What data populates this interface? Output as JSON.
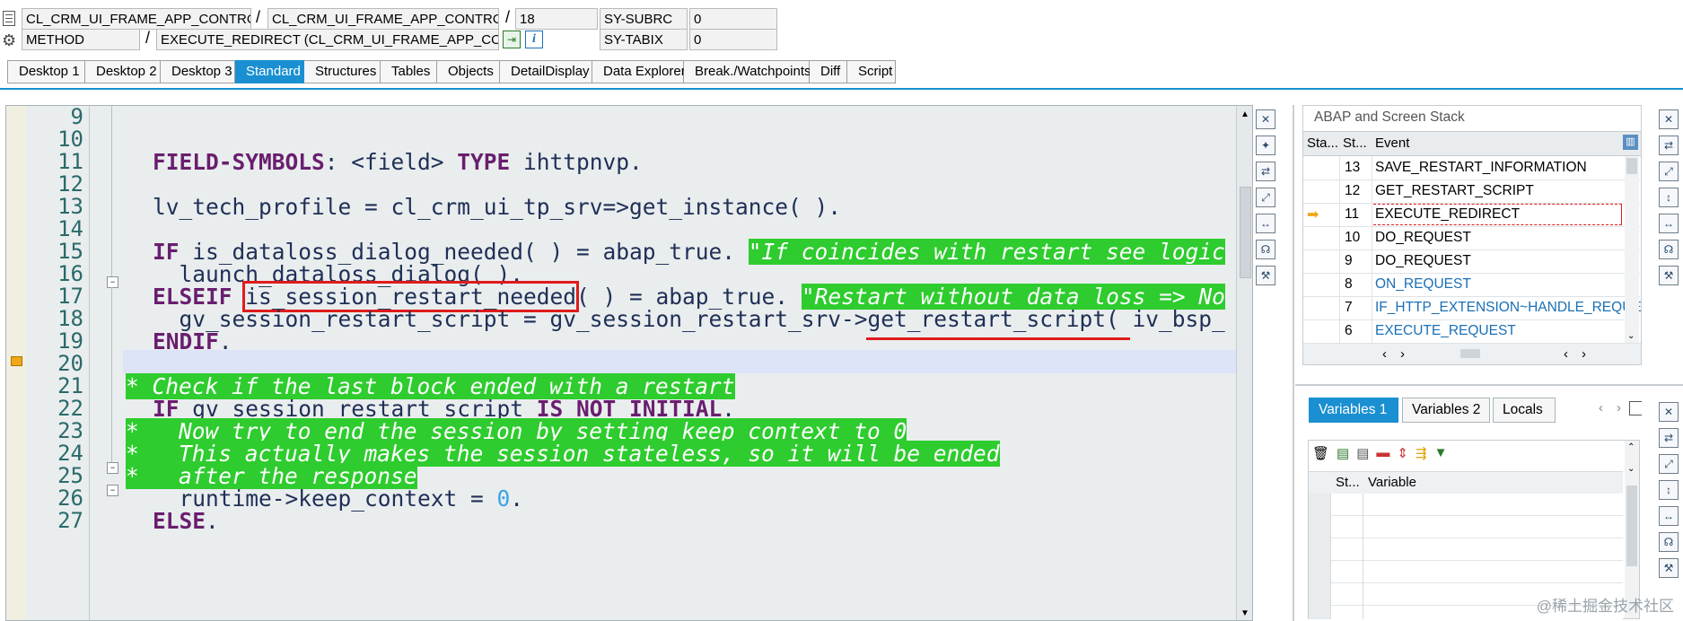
{
  "header": {
    "row1": {
      "class_field": "CL_CRM_UI_FRAME_APP_CONTROLLE...",
      "include_field": "CL_CRM_UI_FRAME_APP_CONTROLLE...",
      "line_field": "18",
      "sysvar_label": "SY-SUBRC",
      "sysvar_value": "0"
    },
    "row2": {
      "type_field": "METHOD",
      "method_field": "EXECUTE_REDIRECT (CL_CRM_UI_FRAME_APP_CONTROLLE...",
      "sysvar_label": "SY-TABIX",
      "sysvar_value": "0"
    },
    "separator": "/"
  },
  "tabs": [
    "Desktop 1",
    "Desktop 2",
    "Desktop 3",
    "Standard",
    "Structures",
    "Tables",
    "Objects",
    "DetailDisplay",
    "Data Explorer",
    "Break./Watchpoints",
    "Diff",
    "Script"
  ],
  "active_tab": "Standard",
  "code": {
    "line_numbers": [
      "9",
      "10",
      "11",
      "12",
      "13",
      "14",
      "15",
      "16",
      "17",
      "18",
      "19",
      "20",
      "21",
      "22",
      "23",
      "24",
      "25",
      "26",
      "27"
    ],
    "l11_kw1": "FIELD-SYMBOLS",
    "l11_rest": ": <field> ",
    "l11_kw2": "TYPE",
    "l11_type": " ihttpnvp.",
    "l13": "lv_tech_profile = cl_crm_ui_tp_srv=>get_instance( ).",
    "l15_kw": "IF",
    "l15_rest": " is_dataloss_dialog_needed( ) = abap_true. ",
    "l15_comment": "\"If coincides with restart see logic",
    "l16": "  launch_dataloss_dialog( ).",
    "l17_kw": "ELSEIF",
    "l17_boxed": "is_session_restart_needed",
    "l17_rest": "( ) = abap_true. ",
    "l17_comment": "\"Restart without data loss => No",
    "l18_a": "  gv_session_restart_script = gv_session_restart_srv->",
    "l18_b": "get_restart_script",
    "l18_c": "( iv_bsp_",
    "l19_kw": "ENDIF",
    "l19_rest": ".",
    "l21_comment": "* Check if the last block ended with a restart",
    "l22_kw1": "IF",
    "l22_rest": " gv_session_restart_script ",
    "l22_kw2": "IS NOT INITIAL",
    "l22_end": ".",
    "l23_comment": "*   Now try to end the session by setting keep_context to 0",
    "l24_comment": "*   This actually makes the session stateless, so it will be ended",
    "l25_comment": "*   after the response",
    "l26_a": "  runtime->keep_context = ",
    "l26_num": "0",
    "l26_b": ".",
    "l27_kw": "ELSE",
    "l27_rest": "."
  },
  "stack": {
    "title": "ABAP and Screen Stack",
    "columns": [
      "Sta...",
      "St...",
      "Event"
    ],
    "rows": [
      {
        "level": "13",
        "event": "SAVE_RESTART_INFORMATION",
        "link": false,
        "current": false
      },
      {
        "level": "12",
        "event": "GET_RESTART_SCRIPT",
        "link": false,
        "current": false
      },
      {
        "level": "11",
        "event": "EXECUTE_REDIRECT",
        "link": false,
        "current": true
      },
      {
        "level": "10",
        "event": "DO_REQUEST",
        "link": false,
        "current": false
      },
      {
        "level": "9",
        "event": "DO_REQUEST",
        "link": false,
        "current": false
      },
      {
        "level": "8",
        "event": "ON_REQUEST",
        "link": true,
        "current": false
      },
      {
        "level": "7",
        "event": "IF_HTTP_EXTENSION~HANDLE_REQUE...",
        "link": true,
        "current": false
      },
      {
        "level": "6",
        "event": "EXECUTE_REQUEST",
        "link": true,
        "current": false
      }
    ]
  },
  "variables": {
    "tabs": [
      "Variables 1",
      "Variables 2",
      "Locals"
    ],
    "active": "Variables 1",
    "columns": [
      "St...",
      "Variable"
    ]
  },
  "watermark": "@稀土掘金技术社区",
  "colors": {
    "accent": "#1a8fd1",
    "comment_bg": "#2ecc2e",
    "keyword": "#6a1e6e",
    "box": "#e01b1b"
  }
}
